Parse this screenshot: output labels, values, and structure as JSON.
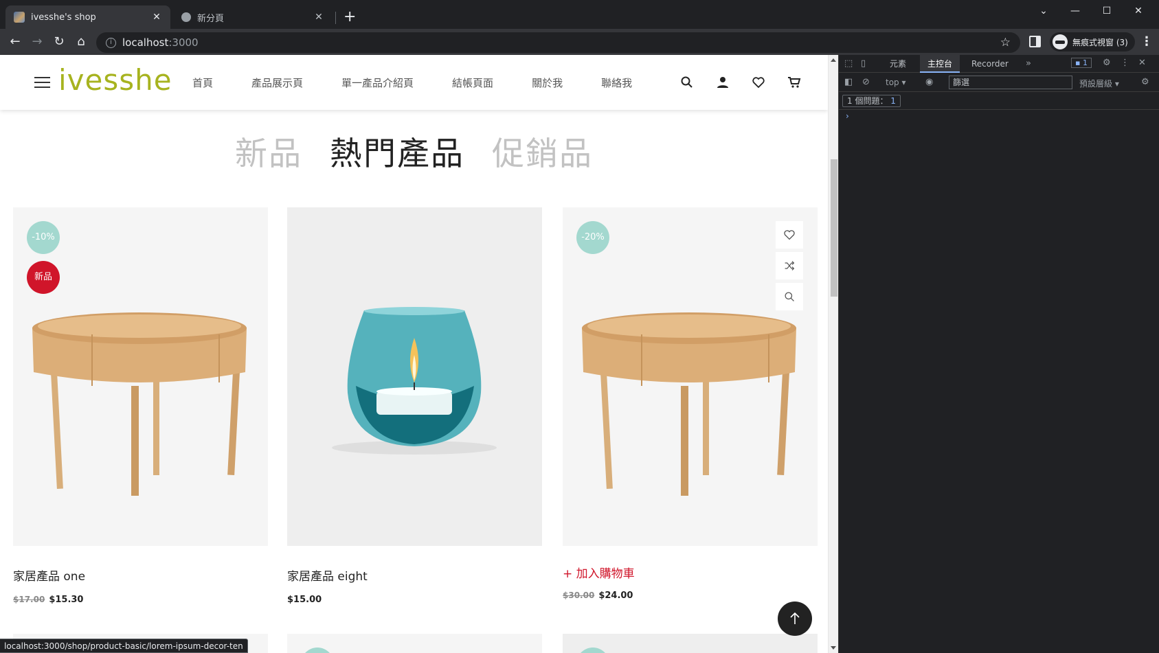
{
  "browser": {
    "tabs": [
      {
        "title": "ivesshe's shop",
        "active": true,
        "icon": "site-favicon"
      },
      {
        "title": "新分頁",
        "active": false,
        "icon": "incognito-icon"
      }
    ],
    "new_tab": "+",
    "close": "✕",
    "url_host": "localhost",
    "url_port": ":3000",
    "profile_label": "無痕式視窗 (3)",
    "status_url": "localhost:3000/shop/product-basic/lorem-ipsum-decor-ten"
  },
  "site": {
    "logo": "ivesshe",
    "nav": [
      "首頁",
      "產品展示頁",
      "單一產品介紹頁",
      "結帳頁面",
      "關於我",
      "聯絡我"
    ],
    "section_tabs": [
      "新品",
      "熱門產品",
      "促銷品"
    ],
    "active_tab": "熱門產品",
    "products": [
      {
        "name": "家居產品 one",
        "old_price": "$17.00",
        "price": "$15.30",
        "discount": "-10%",
        "new_badge": "新品",
        "image": "wooden-table"
      },
      {
        "name": "家居產品 eight",
        "old_price": "",
        "price": "$15.00",
        "discount": "",
        "new_badge": "",
        "image": "glass-candle"
      },
      {
        "name": "",
        "add_to_cart": "+ 加入購物車",
        "old_price": "$30.00",
        "price": "$24.00",
        "discount": "-20%",
        "new_badge": "",
        "image": "wooden-table"
      }
    ],
    "accent": "#a7b31f",
    "badge_discount_color": "#a3d8cf",
    "badge_new_color": "#d0152a"
  },
  "devtools": {
    "tabs": [
      "元素",
      "主控台",
      "Recorder"
    ],
    "active_tab": "主控台",
    "context": "top",
    "filter_placeholder": "篩選",
    "levels": "預設層級",
    "issues_label": "1 個問題：",
    "issues_count": "1",
    "message_count": "1",
    "prompt": "›"
  }
}
